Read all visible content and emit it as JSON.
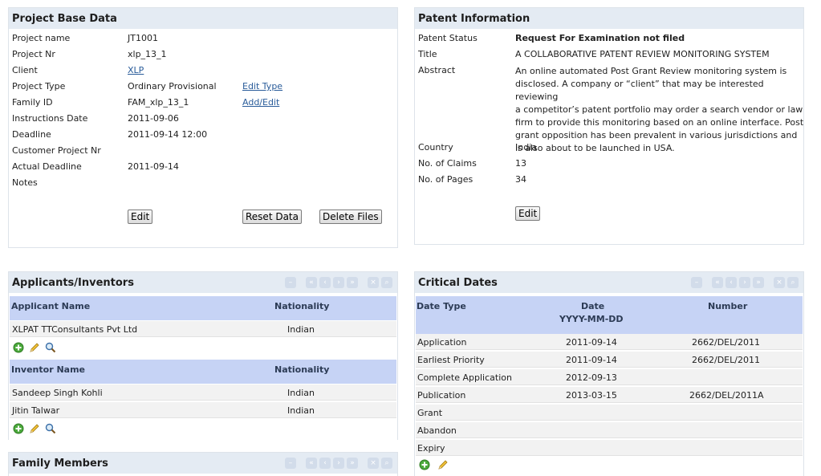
{
  "project_base": {
    "title": "Project Base Data",
    "fields": [
      {
        "label": "Project name",
        "value": "JT1001"
      },
      {
        "label": "Project Nr",
        "value": "xlp_13_1"
      },
      {
        "label": "Client",
        "value": "XLP"
      },
      {
        "label": "Project Type",
        "value": "Ordinary Provisional",
        "action": "Edit Type"
      },
      {
        "label": "Family ID",
        "value": "FAM_xlp_13_1",
        "action": "Add/Edit"
      },
      {
        "label": "Instructions Date",
        "value": "2011-09-06"
      },
      {
        "label": "Deadline",
        "value": "2011-09-14 12:00"
      },
      {
        "label": "Customer Project Nr",
        "value": ""
      },
      {
        "label": "Actual Deadline",
        "value": "2011-09-14"
      },
      {
        "label": "Notes",
        "value": ""
      }
    ],
    "buttons": {
      "edit": "Edit",
      "reset": "Reset Data",
      "delete": "Delete Files"
    }
  },
  "patent_info": {
    "title": "Patent Information",
    "status_label": "Patent Status",
    "status_value": "Request For Examination not filed",
    "title_label": "Title",
    "title_value": "A COLLABORATIVE PATENT REVIEW MONITORING SYSTEM",
    "abstract_label": "Abstract",
    "abstract_lines": [
      "An online automated Post Grant Review monitoring system is",
      "disclosed. A company or “client” that may be interested reviewing",
      "a competitor’s patent portfolio may order a search vendor or law",
      "firm to provide this monitoring based on an online interface. Post",
      "grant opposition has been prevalent in various jurisdictions and",
      "is also about to be launched in USA."
    ],
    "country_label": "Country",
    "country_value": "India",
    "claims_label": "No. of Claims",
    "claims_value": "13",
    "pages_label": "No. of Pages",
    "pages_value": "34",
    "edit_button": "Edit"
  },
  "applicants": {
    "title": "Applicants/Inventors",
    "applicant_headers": {
      "name": "Applicant Name",
      "nationality": "Nationality"
    },
    "applicant_rows": [
      {
        "name": "XLPAT TTConsultants Pvt Ltd",
        "nationality": "Indian"
      }
    ],
    "inventor_headers": {
      "name": "Inventor Name",
      "nationality": "Nationality"
    },
    "inventor_rows": [
      {
        "name": "Sandeep Singh Kohli",
        "nationality": "Indian"
      },
      {
        "name": "Jitin Talwar",
        "nationality": "Indian"
      }
    ]
  },
  "critical_dates": {
    "title": "Critical Dates",
    "headers": {
      "type": "Date Type",
      "date": "Date",
      "date_format": "YYYY-MM-DD",
      "number": "Number"
    },
    "rows": [
      {
        "type": "Application",
        "date": "2011-09-14",
        "number": "2662/DEL/2011"
      },
      {
        "type": "Earliest Priority",
        "date": "2011-09-14",
        "number": "2662/DEL/2011"
      },
      {
        "type": "Complete Application",
        "date": "2012-09-13",
        "number": ""
      },
      {
        "type": "Publication",
        "date": "2013-03-15",
        "number": "2662/DEL/2011A"
      },
      {
        "type": "Grant",
        "date": "",
        "number": ""
      },
      {
        "type": "Abandon",
        "date": "",
        "number": ""
      },
      {
        "type": "Expiry",
        "date": "",
        "number": ""
      }
    ]
  },
  "family_members": {
    "title": "Family Members"
  },
  "icons": {
    "add": "add-circle-icon",
    "edit": "pencil-icon",
    "search": "magnifier-icon"
  }
}
